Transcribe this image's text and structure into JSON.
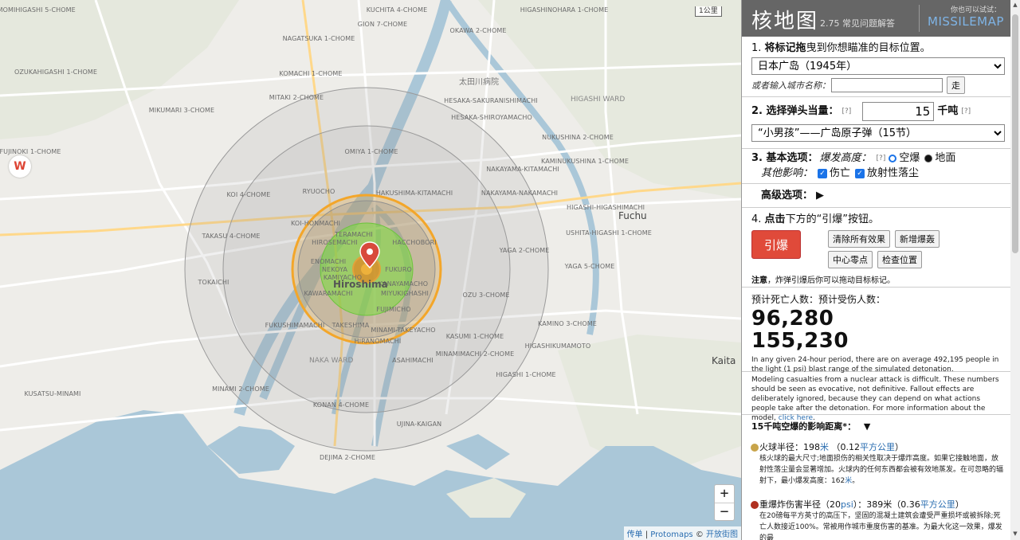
{
  "header": {
    "title": "核地图",
    "version": "2.75",
    "faq": "常见问题解答",
    "try_label": "你也可以试试：",
    "missilemap": "MISSILEMAP"
  },
  "step1": {
    "prefix": "1. ",
    "bold": "将标记拖",
    "rest": "曳到你想瞄准的目标位置。",
    "location_selected": "日本广岛（1945年）",
    "city_prompt": "或者输入城市名称：",
    "city_input_value": "",
    "go_label": "走"
  },
  "step2": {
    "label": "2. 选择弹头当量：",
    "help": "[?]",
    "yield_value": "15",
    "unit": "千吨",
    "unit_help": "[?]",
    "preset_selected": "“小男孩”——广岛原子弹（15节）"
  },
  "step3": {
    "label": "3. 基本选项：",
    "burst_label": "爆发高度：",
    "help": "[?]",
    "airburst": "空爆",
    "surface": "地面",
    "other_label": "其他影响：",
    "casualties": "伤亡",
    "fallout": "放射性落尘"
  },
  "advanced": {
    "label": "高级选项：",
    "arrow": "▶"
  },
  "step4": {
    "prefix": "4. ",
    "bold": "点击",
    "rest": "下方的“引爆”按钮。",
    "detonate": "引爆",
    "clear_effects": "清除所有效果",
    "add_detonation": "新增爆轰",
    "center_zero": "中心零点",
    "check_position": "检查位置",
    "note_bold": "注意",
    "note_rest": "，炸弹引爆后你可以拖动目标标记。"
  },
  "results": {
    "label": "预计死亡人数：预计受伤人数：",
    "deaths": "96,280",
    "injuries": "155,230",
    "population_note": "In any given 24-hour period, there are on average 492,195 people in the light (1 psi) blast range of the simulated detonation.",
    "disclaimer": "Modeling casualties from a nuclear attack is difficult. These numbers should be seen as evocative, not definitive. Fallout effects are deliberately ignored, because they can depend on what actions people take after the detonation. For more information about the model, ",
    "link": "click here",
    "period": "."
  },
  "effects": {
    "heading_yield": "15",
    "heading_unit": "千吨",
    "heading_rest": "空爆的影响距离*：",
    "toggle": "▼",
    "items": [
      {
        "color": "#c8a44a",
        "title_pre": "火球半径：",
        "value": "198",
        "unit": "米",
        "area_pre": "（0.12",
        "area_unit": "平方公里",
        "area_post": "）",
        "desc": "核火球的最大尺寸;地面损伤的相关性取决于爆炸高度。如果它接触地面，放射性落尘量会显著增加。火球内的任何东西都会被有效地蒸发。在可忽略的辐射下，最小爆发高度：",
        "desc_value": "162",
        "desc_unit": "米",
        "desc_end": "。"
      },
      {
        "color": "#b03020",
        "title_pre": "重爆炸伤害半径（20",
        "value": "psi",
        "unit": "）：",
        "area_pre": "389米（0.36",
        "area_unit": "平方公里",
        "area_post": "）",
        "desc": "在20磅每平方英寸的高压下，坚固的混凝土建筑会遭受严重损坏或被拆除;死亡人数接近100%。常被用作城市重度伤害的基准。为最大化这一效果，爆发的最",
        "desc_value": "",
        "desc_unit": "",
        "desc_end": ""
      }
    ]
  },
  "map": {
    "scale": "1公里",
    "zoom_in": "+",
    "zoom_out": "−",
    "attrib_1": "传单",
    "attrib_sep": " | ",
    "attrib_2": "Protomaps",
    "attrib_3": " © ",
    "attrib_4": "开放街图",
    "city": "Hiroshima",
    "places": [
      "Fuchu",
      "Kaita",
      "HIGASHI WARD",
      "NAKA WARD",
      "太田川病院"
    ],
    "labels": [
      "TOMOMIHIGASHI 5-CHOME",
      "OZUKAHIGASHI 1-CHOME",
      "KUCHITA 4-CHOME",
      "GION 7-CHOME",
      "HIGASHINOHARA 1-CHOME",
      "OKAWA 2-CHOME",
      "NAGATSUKA 1-CHOME",
      "KOMACHI 1-CHOME",
      "MITAKI 2-CHOME",
      "HESAKA-SAKURANISHIMACHI",
      "MIKUMARI 3-CHOME",
      "HESAKA-SHIROYAMACHO",
      "FUJINOKI 1-CHOME",
      "OMIYA 1-CHOME",
      "NUKUSHINA 2-CHOME",
      "KOI 4-CHOME",
      "RYUOCHO",
      "NAKAYAMA-KITAMACHI",
      "KAMINUKUSHINA 1-CHOME",
      "HAKUSHIMA-KITAMACHI",
      "NAKAYAMA-NAKAMACHI",
      "HIGASHI-HIGASHIMACHI",
      "KOI-HONMACHI",
      "TERAMACHI",
      "USHITA-HIGASHI 1-CHOME",
      "TAKASU 4-CHOME",
      "HIROSEMACHI",
      "HACCHOBORI",
      "ENOMACHI",
      "NEKOYA",
      "YAGA 2-CHOME",
      "YAGA 5-CHOME",
      "TOKAICHI",
      "KAMIYACHO",
      "FUKURO",
      "KAWARAMACHI",
      "KANAYAMACHO",
      "FUJIMICHO",
      "MIYUKIGHASHI",
      "OZU 3-CHOME",
      "KAMINO 3-CHOME",
      "FUKUSHIMAMACHI",
      "TAKESHIMA",
      "MINAMI-TAKEYACHO",
      "MINAMIMACHI 2-CHOME",
      "ASAHIMACHI",
      "HIRANOMACHI",
      "KASUMI 1-CHOME",
      "HIGASHI 1-CHOME",
      "HIGASHIKUMAMOTO",
      "KONAN 4-CHOME",
      "KUSATSU-MINAMI",
      "UJINA-KAIGAN",
      "DEJIMA 2-CHOME",
      "MINAMI 2-CHOME"
    ]
  }
}
